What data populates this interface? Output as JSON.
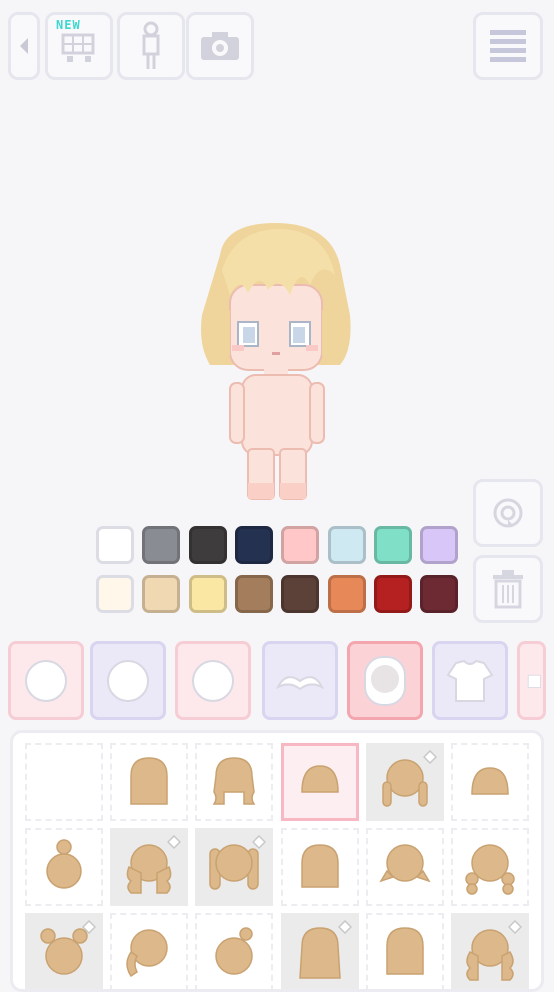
{
  "toolbar": {
    "new_badge": "NEW",
    "icons": [
      "back-arrow-icon",
      "cart-icon",
      "body-icon",
      "camera-icon",
      "menu-icon"
    ]
  },
  "side_actions": [
    "rotate-icon",
    "trash-icon"
  ],
  "colors": {
    "row1": [
      "#ffffff",
      "#8a8c94",
      "#3e3c3d",
      "#243150",
      "#ffc7c7",
      "#cfe9f3",
      "#7fe0c7",
      "#d7c6f7"
    ],
    "row2": [
      "#fff8ea",
      "#f0d8b2",
      "#fbe7a4",
      "#a47d5c",
      "#5c4138",
      "#e68857",
      "#b52020",
      "#6e2a33"
    ]
  },
  "tabs": [
    {
      "name": "tab-face-blush",
      "icon": "face-icon"
    },
    {
      "name": "tab-face-plain",
      "icon": "face-icon"
    },
    {
      "name": "tab-face-mouth",
      "icon": "face-icon"
    },
    {
      "name": "tab-eyebrows",
      "icon": "eyebrows-icon"
    },
    {
      "name": "tab-hair",
      "icon": "hair-icon",
      "selected": true
    },
    {
      "name": "tab-tops",
      "icon": "shirt-icon"
    },
    {
      "name": "tab-more",
      "icon": "more-icon"
    }
  ],
  "hair_items": [
    {
      "style": "none"
    },
    {
      "style": "long"
    },
    {
      "style": "wavy"
    },
    {
      "style": "short",
      "selected": true
    },
    {
      "style": "twin-braids",
      "locked": true
    },
    {
      "style": "bob"
    },
    {
      "style": "bun"
    },
    {
      "style": "curly-long",
      "locked": true
    },
    {
      "style": "twintails",
      "locked": true
    },
    {
      "style": "medium"
    },
    {
      "style": "flip"
    },
    {
      "style": "drill-curls"
    },
    {
      "style": "bear-ears",
      "locked": true
    },
    {
      "style": "side-pony"
    },
    {
      "style": "top-bun"
    },
    {
      "style": "long-straight",
      "locked": true
    },
    {
      "style": "long"
    },
    {
      "style": "ringlets",
      "locked": true
    }
  ]
}
